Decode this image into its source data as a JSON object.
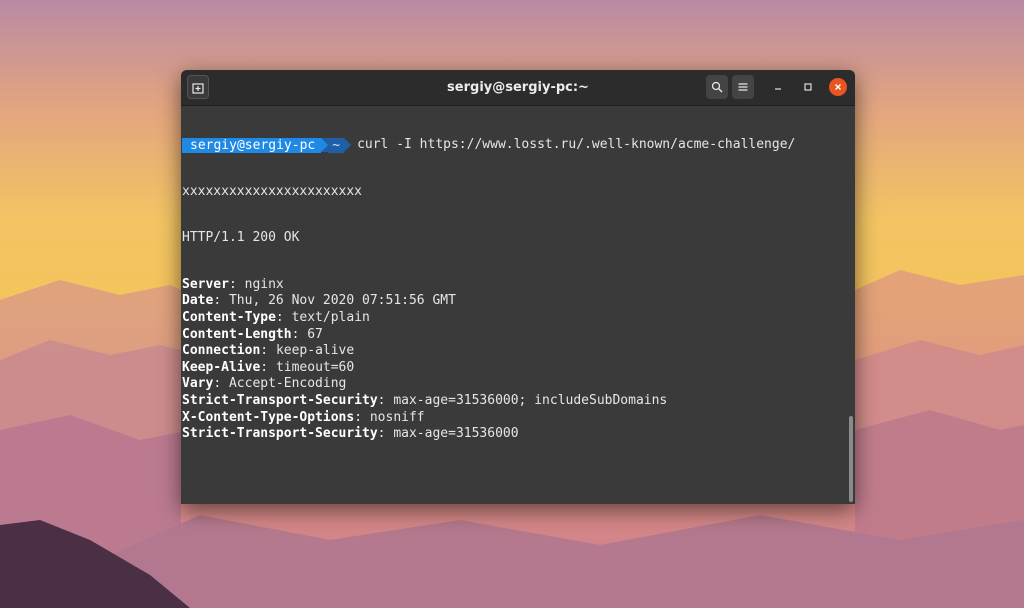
{
  "window": {
    "title": "sergiy@sergiy-pc:~",
    "close_color": "#e95420"
  },
  "toolbar": {
    "new_tab_icon": "new-tab-icon",
    "search_icon": "search-icon",
    "menu_icon": "hamburger-menu-icon"
  },
  "prompt": {
    "user_host": "sergiy@sergiy-pc",
    "dir": "~",
    "user_bg": "#1f8ae6",
    "dir_bg": "#1f5fa8"
  },
  "command": {
    "text": "curl -I https://www.losst.ru/.well-known/acme-challenge/",
    "wrap": "xxxxxxxxxxxxxxxxxxxxxxx"
  },
  "status_line": "HTTP/1.1 200 OK",
  "headers": [
    {
      "name": "Server",
      "value": "nginx"
    },
    {
      "name": "Date",
      "value": "Thu, 26 Nov 2020 07:51:56 GMT"
    },
    {
      "name": "Content-Type",
      "value": "text/plain"
    },
    {
      "name": "Content-Length",
      "value": "67"
    },
    {
      "name": "Connection",
      "value": "keep-alive"
    },
    {
      "name": "Keep-Alive",
      "value": "timeout=60"
    },
    {
      "name": "Vary",
      "value": "Accept-Encoding"
    },
    {
      "name": "Strict-Transport-Security",
      "value": "max-age=31536000; includeSubDomains"
    },
    {
      "name": "X-Content-Type-Options",
      "value": "nosniff"
    },
    {
      "name": "Strict-Transport-Security",
      "value": "max-age=31536000"
    }
  ]
}
